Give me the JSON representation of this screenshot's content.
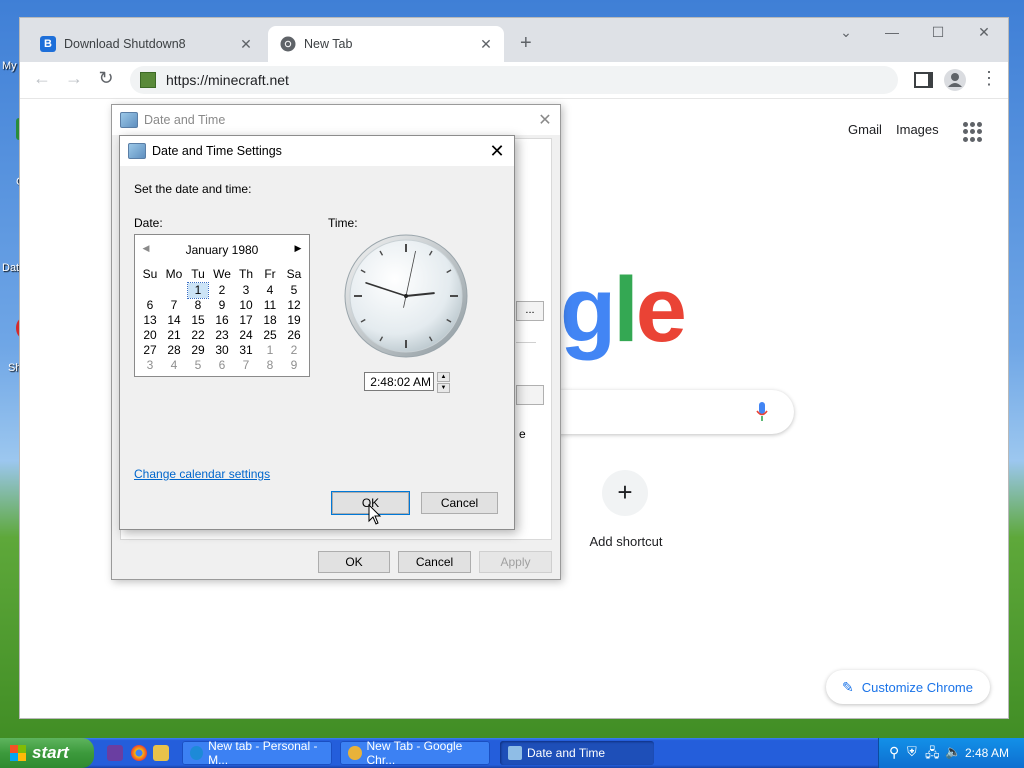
{
  "desktop": {
    "labels": [
      "My",
      "C",
      "Dat",
      "Sh"
    ]
  },
  "browser": {
    "tabs": [
      {
        "title": "Download Shutdown8",
        "favicon": "B"
      },
      {
        "title": "New Tab"
      }
    ],
    "url": "https://minecraft.net",
    "new_tab_symbol": "+",
    "nav": {
      "back": "←",
      "forward": "→",
      "reload": "↻"
    }
  },
  "ntp": {
    "links": [
      "Gmail",
      "Images"
    ],
    "logo_fragment": [
      "g",
      "l",
      "e"
    ],
    "logo_colors": [
      "#4285f4",
      "#34a853",
      "#ea4335"
    ],
    "add_shortcut_symbol": "+",
    "add_shortcut_label": "Add shortcut",
    "customize_label": "Customize Chrome",
    "customize_icon": "✎"
  },
  "dt_outer": {
    "title": "Date and Time",
    "ghost_buttons": [
      "..."
    ],
    "ghost_letter": "e",
    "buttons": {
      "ok": "OK",
      "cancel": "Cancel",
      "apply": "Apply"
    }
  },
  "dts": {
    "title": "Date and Time Settings",
    "instruction": "Set the date and time:",
    "date_label": "Date:",
    "time_label": "Time:",
    "calendar": {
      "month": "January 1980",
      "prev_arrow": "◀",
      "next_arrow": "▶",
      "weekdays": [
        "Su",
        "Mo",
        "Tu",
        "We",
        "Th",
        "Fr",
        "Sa"
      ],
      "weeks": [
        [
          "",
          "",
          "1",
          "2",
          "3",
          "4",
          "5"
        ],
        [
          "6",
          "7",
          "8",
          "9",
          "10",
          "11",
          "12"
        ],
        [
          "13",
          "14",
          "15",
          "16",
          "17",
          "18",
          "19"
        ],
        [
          "20",
          "21",
          "22",
          "23",
          "24",
          "25",
          "26"
        ],
        [
          "27",
          "28",
          "29",
          "30",
          "31",
          "1",
          "2"
        ],
        [
          "3",
          "4",
          "5",
          "6",
          "7",
          "8",
          "9"
        ]
      ],
      "selected": "1"
    },
    "clock": {
      "hour": 2,
      "minute": 48,
      "second": 2
    },
    "time_value": "2:48:02 AM",
    "spin_up": "▲",
    "spin_down": "▼",
    "change_calendar_link": "Change calendar settings",
    "ok": "OK",
    "cancel": "Cancel"
  },
  "taskbar": {
    "start_label": "start",
    "tasks": [
      {
        "label": "New tab - Personal - M...",
        "color": "#1d8ad8"
      },
      {
        "label": "New Tab - Google Chr...",
        "color": "#e8b23a"
      },
      {
        "label": "Date and Time",
        "color": "#8fbde6"
      }
    ],
    "time": "2:48 AM"
  },
  "colors": {
    "link": "#0066cc",
    "chrome_blue": "#1a73e8",
    "taskbar": "#245edb",
    "start_green": "#3c9a3c"
  }
}
